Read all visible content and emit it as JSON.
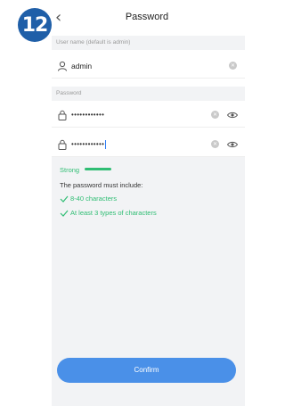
{
  "step_badge": "12",
  "header": {
    "title": "Password",
    "back_icon": "chevron-left-icon"
  },
  "username_section": {
    "label": "User name (default is admin)",
    "value": "admin"
  },
  "password_section": {
    "label": "Password",
    "password_masked": "••••••••••••",
    "confirm_masked": "••••••••••••"
  },
  "strength": {
    "label": "Strong",
    "color": "#2fbd73"
  },
  "requirements": {
    "title": "The password must include:",
    "rules": [
      "8-40 characters",
      "At least 3 types of characters"
    ]
  },
  "confirm_button": {
    "label": "Confirm",
    "color": "#4a90e8"
  }
}
